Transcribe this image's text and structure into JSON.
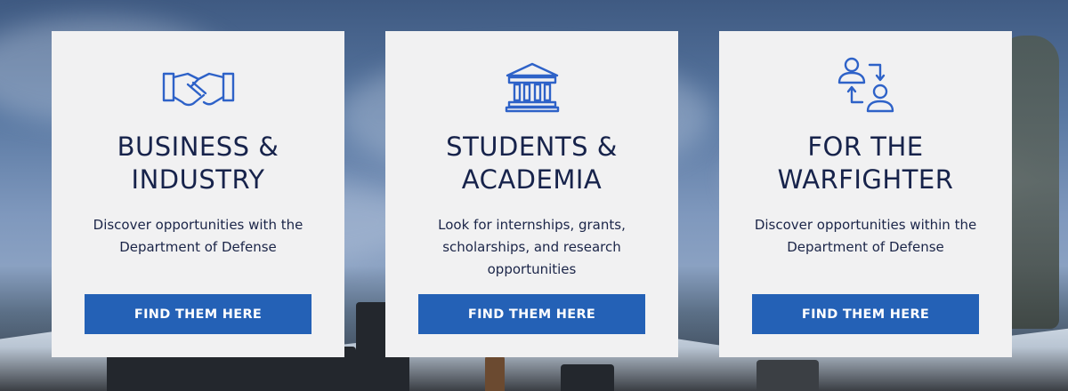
{
  "cards": [
    {
      "icon": "handshake-icon",
      "title_line1": "BUSINESS &",
      "title_line2": "INDUSTRY",
      "desc_line1": "Discover opportunities with the",
      "desc_line2": "Department of Defense",
      "desc_line3": "",
      "button": "FIND THEM HERE"
    },
    {
      "icon": "institution-icon",
      "title_line1": "STUDENTS &",
      "title_line2": "ACADEMIA",
      "desc_line1": "Look for internships, grants,",
      "desc_line2": "scholarships, and research",
      "desc_line3": "opportunities",
      "button": "FIND THEM HERE"
    },
    {
      "icon": "people-exchange-icon",
      "title_line1": "FOR THE",
      "title_line2": "WARFIGHTER",
      "desc_line1": "Discover opportunities within the",
      "desc_line2": "Department of Defense",
      "desc_line3": "",
      "button": "FIND THEM HERE"
    }
  ],
  "colors": {
    "card_bg": "#f1f1f2",
    "title": "#17234b",
    "button_bg": "#2461b6",
    "icon": "#2e62c8"
  }
}
